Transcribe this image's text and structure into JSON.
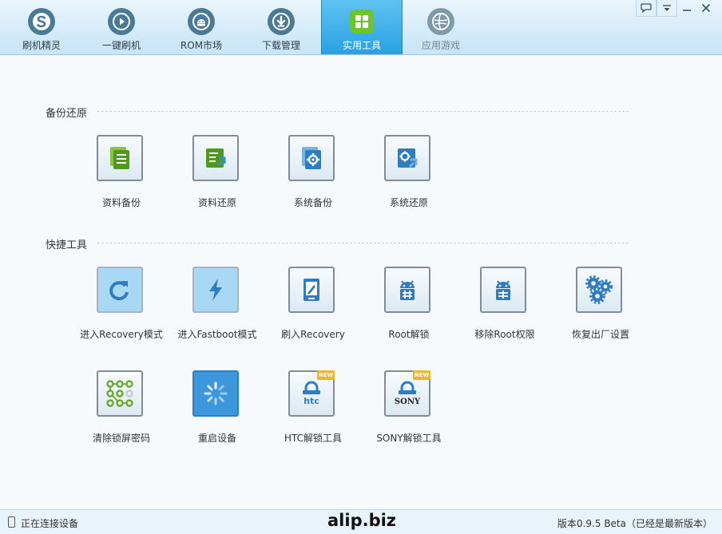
{
  "window": {
    "buttons": [
      "feedback",
      "menu",
      "minimize",
      "close"
    ]
  },
  "tabs": [
    {
      "label": "刷机精灵",
      "icon": "logo-s-icon"
    },
    {
      "label": "一键刷机",
      "icon": "play-icon"
    },
    {
      "label": "ROM市场",
      "icon": "android-icon"
    },
    {
      "label": "下载管理",
      "icon": "download-icon"
    },
    {
      "label": "实用工具",
      "icon": "grid-icon",
      "active": true
    },
    {
      "label": "应用游戏",
      "icon": "game-icon"
    }
  ],
  "sections": {
    "backup": {
      "title": "备份还原",
      "tools": [
        {
          "label": "资料备份",
          "icon": "data-backup-icon"
        },
        {
          "label": "资料还原",
          "icon": "data-restore-icon"
        },
        {
          "label": "系统备份",
          "icon": "system-backup-icon"
        },
        {
          "label": "系统还原",
          "icon": "system-restore-icon"
        }
      ]
    },
    "quick": {
      "title": "快捷工具",
      "tools": [
        {
          "label": "进入Recovery模式",
          "icon": "refresh-icon"
        },
        {
          "label": "进入Fastboot模式",
          "icon": "lightning-icon"
        },
        {
          "label": "刷入Recovery",
          "icon": "tablet-pen-icon"
        },
        {
          "label": "Root解锁",
          "icon": "android-unlock-icon"
        },
        {
          "label": "移除Root权限",
          "icon": "android-remove-icon"
        },
        {
          "label": "恢复出厂设置",
          "icon": "gears-icon"
        },
        {
          "label": "清除锁屏密码",
          "icon": "pattern-lock-icon"
        },
        {
          "label": "重启设备",
          "icon": "loading-icon"
        },
        {
          "label": "HTC解锁工具",
          "icon": "htc-lock-icon",
          "badge": "NEW",
          "brand": "htc"
        },
        {
          "label": "SONY解锁工具",
          "icon": "sony-lock-icon",
          "badge": "NEW",
          "brand": "SONY"
        }
      ]
    }
  },
  "status": {
    "connection": "正在连接设备",
    "watermark": "alip.biz",
    "version": "版本0.9.5 Beta（已经是最新版本）"
  },
  "colors": {
    "accent": "#2aa1e2",
    "green": "#6bc52b",
    "iconBlue": "#2e7cc1"
  }
}
